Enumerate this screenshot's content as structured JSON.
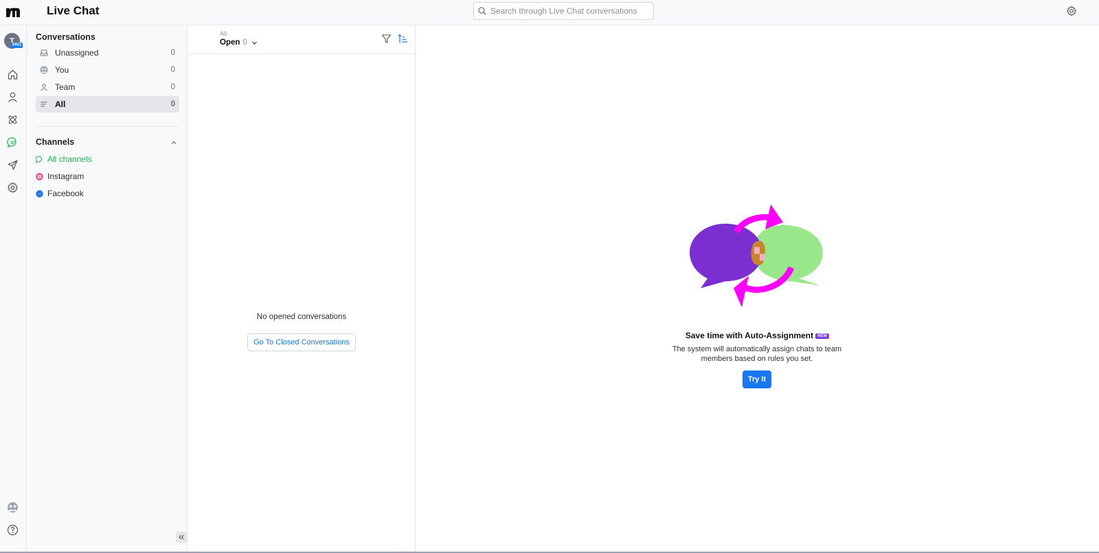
{
  "header": {
    "title": "Live Chat",
    "search_placeholder": "Search through Live Chat conversations",
    "settings_icon": "gear-icon"
  },
  "rail": {
    "avatar_initial": "T",
    "pro_badge": "PRO",
    "icons": [
      "home-icon",
      "contacts-icon",
      "integrations-icon",
      "live-chat-icon",
      "broadcast-icon",
      "settings-icon",
      "team-avatars-icon",
      "help-icon"
    ],
    "active_icon": "live-chat-icon"
  },
  "sidebar": {
    "conversations_title": "Conversations",
    "items": [
      {
        "label": "Unassigned",
        "count": "0",
        "icon": "inbox-icon"
      },
      {
        "label": "You",
        "count": "0",
        "icon": "user-avatar-icon"
      },
      {
        "label": "Team",
        "count": "0",
        "icon": "user-icon"
      },
      {
        "label": "All",
        "count": "0",
        "icon": "list-icon",
        "active": true
      }
    ],
    "channels_title": "Channels",
    "channels": [
      {
        "label": "All channels",
        "icon": "chat-bubbles-icon",
        "active": true
      },
      {
        "label": "Instagram",
        "icon": "instagram-icon"
      },
      {
        "label": "Facebook",
        "icon": "messenger-icon"
      }
    ]
  },
  "list": {
    "scope_label": "All",
    "status_label": "Open",
    "status_count": "0",
    "empty_text": "No opened conversations",
    "closed_button": "Go To Closed Conversations"
  },
  "main": {
    "promo_title": "Save time with Auto-Assignment",
    "new_badge": "NEW",
    "promo_desc": "The system will automatically assign chats to team members based on rules you set.",
    "try_button": "Try It"
  },
  "colors": {
    "accent_blue": "#1877f2",
    "active_green": "#22b24c",
    "bubble_purple": "#7b2fd0",
    "bubble_green": "#98e88b",
    "arrow_magenta": "#ff00ff"
  }
}
